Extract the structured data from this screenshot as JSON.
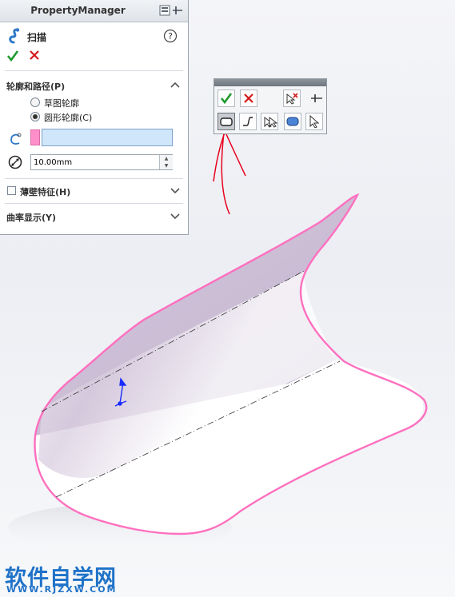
{
  "property_manager": {
    "title": "PropertyManager",
    "feature_name": "扫描",
    "groups": {
      "profile_path": {
        "title": "轮廓和路径(P)",
        "options": [
          "草图轮廓",
          "圆形轮廓(C)"
        ],
        "selected": "圆形轮廓(C)"
      },
      "thin_feature": {
        "title": "薄壁特征(H)"
      },
      "curvature_display": {
        "title": "曲率显示(Y)"
      }
    },
    "diameter_value": "10.00mm"
  },
  "colors": {
    "accent_pink": "#ff5fb0",
    "selection_blue": "#cfe6fb",
    "annotation_red": "#e8001c",
    "brand_blue": "#1f72c8"
  },
  "watermark": {
    "text": "软件自学网",
    "url": "WWW.RJZXW.COM"
  }
}
